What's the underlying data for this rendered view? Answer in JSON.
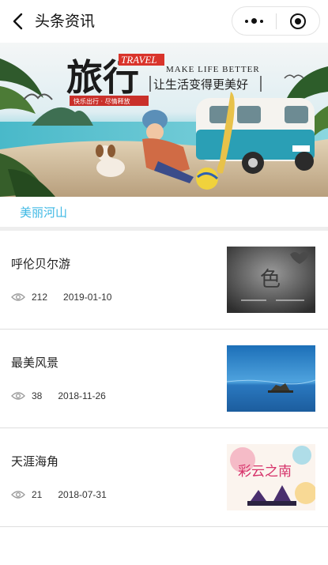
{
  "navbar": {
    "title": "头条资讯",
    "back_icon": "chevron-left-icon",
    "menu_icon": "more-dots-icon",
    "close_icon": "target-circle-icon"
  },
  "banner": {
    "big_text": "旅行",
    "tag_text": "TRAVEL",
    "sub_text": "MAKE LIFE BETTER",
    "slogan": "让生活变得更美好",
    "chip_text": "快乐出行 · 尽情释放"
  },
  "category": {
    "label": "美丽河山",
    "color": "#3cb8e4"
  },
  "news": [
    {
      "title": "呼伦贝尔游",
      "views": "212",
      "date": "2019-01-10",
      "thumb": {
        "text": "色"
      }
    },
    {
      "title": "最美风景",
      "views": "38",
      "date": "2018-11-26"
    },
    {
      "title": "天涯海角",
      "views": "21",
      "date": "2018-07-31",
      "thumb": {
        "text": "彩云之南"
      }
    }
  ]
}
